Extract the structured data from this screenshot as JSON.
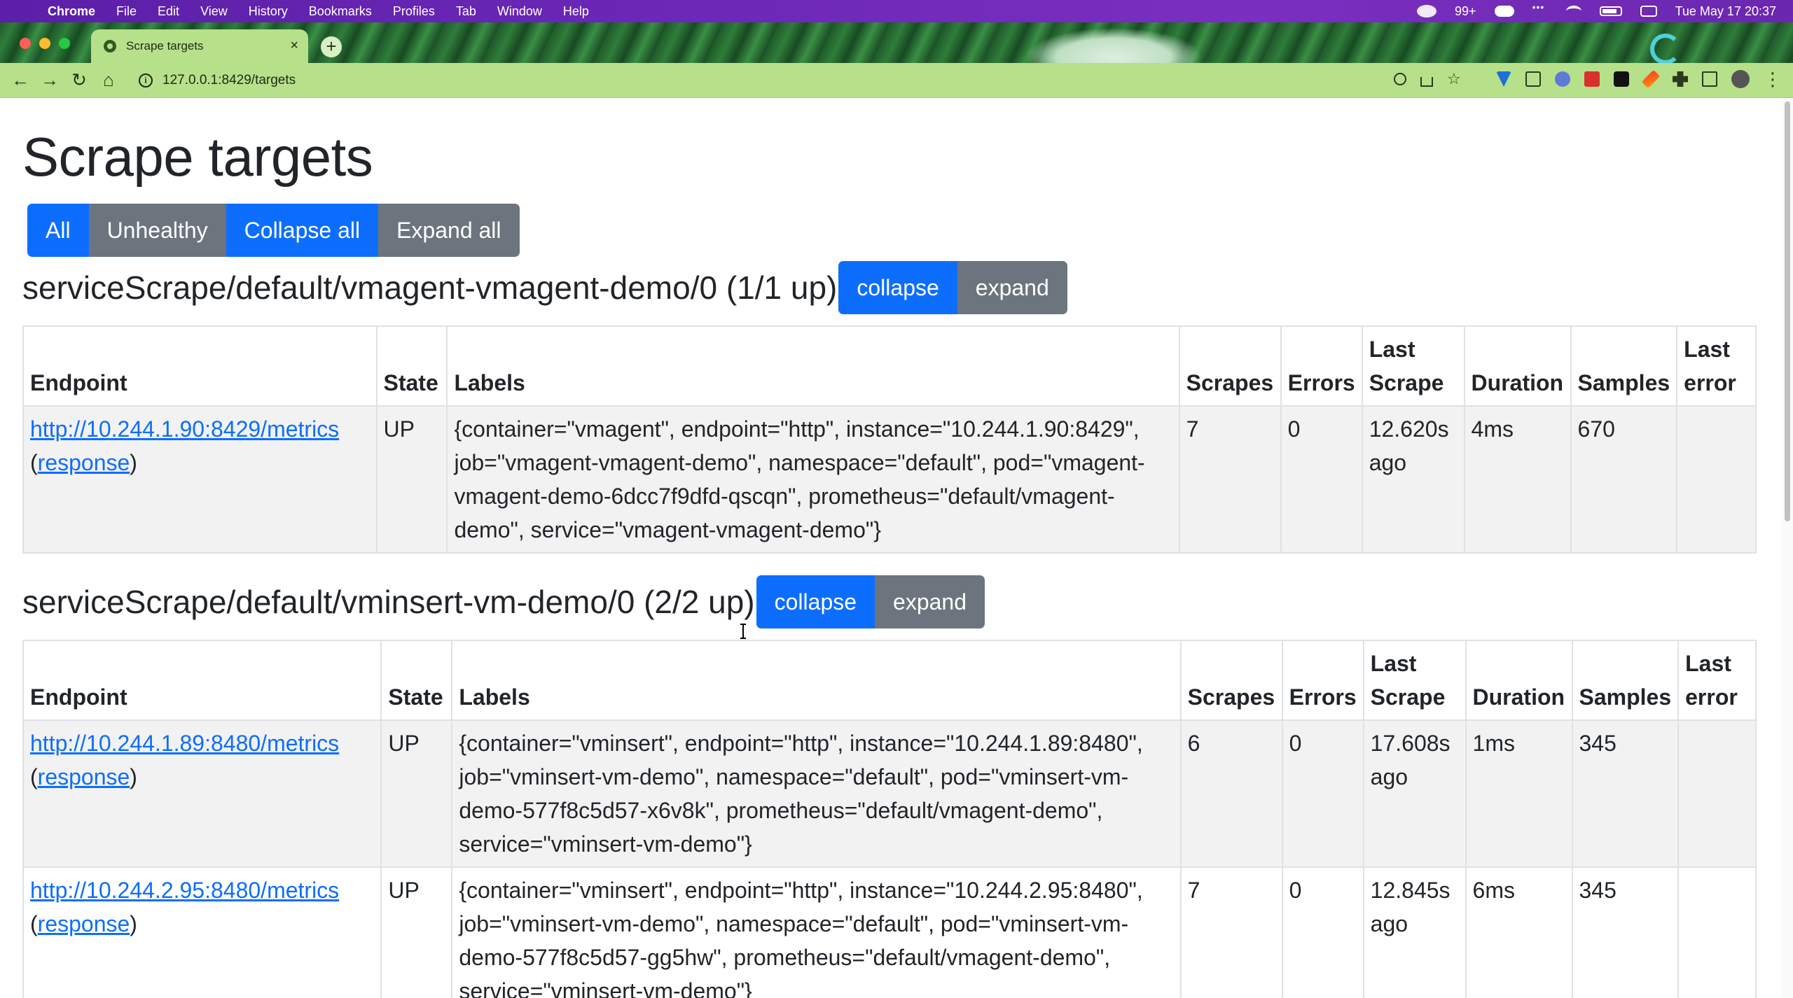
{
  "menubar": {
    "app": "Chrome",
    "items": [
      "File",
      "Edit",
      "View",
      "History",
      "Bookmarks",
      "Profiles",
      "Tab",
      "Window",
      "Help"
    ],
    "notif_count": "99+",
    "clock": "Tue May 17  20:37"
  },
  "browser": {
    "tab_title": "Scrape targets",
    "url": "127.0.0.1:8429/targets"
  },
  "page": {
    "title": "Scrape targets",
    "filters": {
      "all": "All",
      "unhealthy": "Unhealthy",
      "collapse_all": "Collapse all",
      "expand_all": "Expand all"
    },
    "columns": {
      "endpoint": "Endpoint",
      "state": "State",
      "labels": "Labels",
      "scrapes": "Scrapes",
      "errors": "Errors",
      "last_scrape": "Last Scrape",
      "duration": "Duration",
      "samples": "Samples",
      "last_error": "Last error"
    },
    "group_buttons": {
      "collapse": "collapse",
      "expand": "expand"
    },
    "groups": [
      {
        "title": "serviceScrape/default/vmagent-vmagent-demo/0 (1/1 up)",
        "rows": [
          {
            "endpoint": "http://10.244.1.90:8429/metrics",
            "response_open": "(",
            "response": "response",
            "response_close": ")",
            "state": "UP",
            "labels": "{container=\"vmagent\", endpoint=\"http\", instance=\"10.244.1.90:8429\", job=\"vmagent-vmagent-demo\", namespace=\"default\", pod=\"vmagent-vmagent-demo-6dcc7f9dfd-qscqn\", prometheus=\"default/vmagent-demo\", service=\"vmagent-vmagent-demo\"}",
            "scrapes": "7",
            "errors": "0",
            "last_scrape": "12.620s ago",
            "duration": "4ms",
            "samples": "670",
            "last_error": ""
          }
        ]
      },
      {
        "title": "serviceScrape/default/vminsert-vm-demo/0 (2/2 up)",
        "rows": [
          {
            "endpoint": "http://10.244.1.89:8480/metrics",
            "response_open": "(",
            "response": "response",
            "response_close": ")",
            "state": "UP",
            "labels": "{container=\"vminsert\", endpoint=\"http\", instance=\"10.244.1.89:8480\", job=\"vminsert-vm-demo\", namespace=\"default\", pod=\"vminsert-vm-demo-577f8c5d57-x6v8k\", prometheus=\"default/vmagent-demo\", service=\"vminsert-vm-demo\"}",
            "scrapes": "6",
            "errors": "0",
            "last_scrape": "17.608s ago",
            "duration": "1ms",
            "samples": "345",
            "last_error": ""
          },
          {
            "endpoint": "http://10.244.2.95:8480/metrics",
            "response_open": "(",
            "response": "response",
            "response_close": ")",
            "state": "UP",
            "labels": "{container=\"vminsert\", endpoint=\"http\", instance=\"10.244.2.95:8480\", job=\"vminsert-vm-demo\", namespace=\"default\", pod=\"vminsert-vm-demo-577f8c5d57-gg5hw\", prometheus=\"default/vmagent-demo\", service=\"vminsert-vm-demo\"}",
            "scrapes": "7",
            "errors": "0",
            "last_scrape": "12.845s ago",
            "duration": "6ms",
            "samples": "345",
            "last_error": ""
          }
        ]
      }
    ]
  }
}
